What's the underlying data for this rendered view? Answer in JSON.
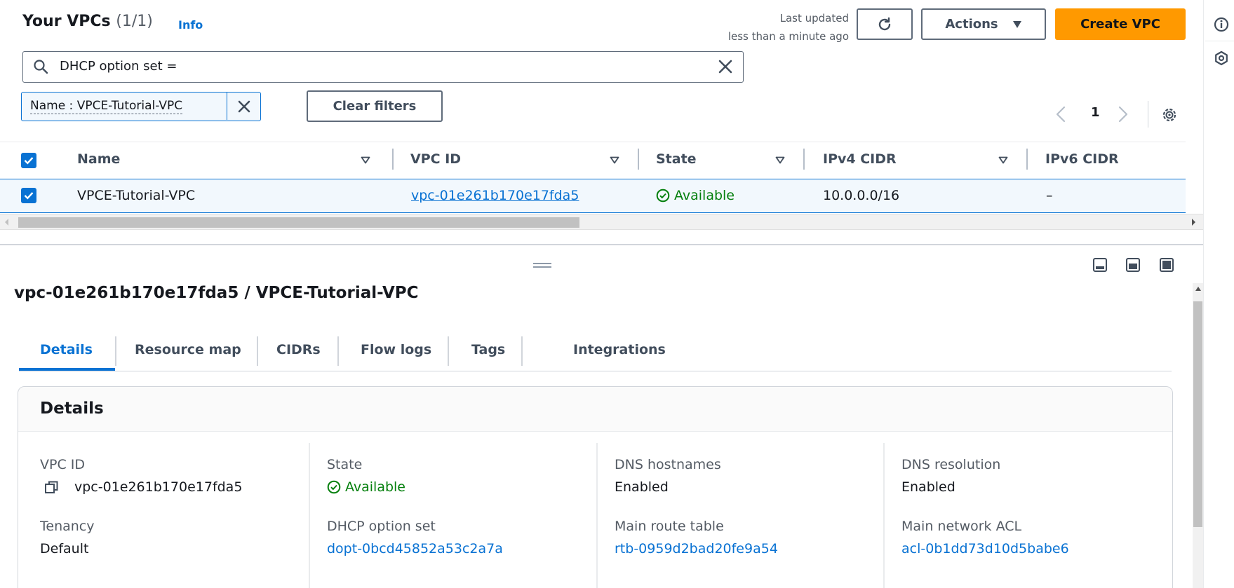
{
  "header": {
    "title": "Your VPCs",
    "count": "(1/1)",
    "info": "Info",
    "last_updated_line1": "Last updated",
    "last_updated_line2": "less than a minute ago",
    "actions_label": "Actions",
    "create_label": "Create VPC"
  },
  "search": {
    "value": "DHCP option set ="
  },
  "filters": {
    "token_label": "Name : VPCE-Tutorial-VPC",
    "clear_label": "Clear filters"
  },
  "pagination": {
    "page": "1"
  },
  "table": {
    "columns": [
      "Name",
      "VPC ID",
      "State",
      "IPv4 CIDR",
      "IPv6 CIDR"
    ],
    "rows": [
      {
        "name": "VPCE-Tutorial-VPC",
        "vpc_id": "vpc-01e261b170e17fda5",
        "state": "Available",
        "ipv4_cidr": "10.0.0.0/16",
        "ipv6_cidr": "–"
      }
    ]
  },
  "panel": {
    "title": "vpc-01e261b170e17fda5 / VPCE-Tutorial-VPC",
    "tabs": [
      "Details",
      "Resource map",
      "CIDRs",
      "Flow logs",
      "Tags",
      "Integrations"
    ],
    "details_title": "Details",
    "fields": {
      "vpc_id_label": "VPC ID",
      "vpc_id_value": "vpc-01e261b170e17fda5",
      "state_label": "State",
      "state_value": "Available",
      "dns_hostnames_label": "DNS hostnames",
      "dns_hostnames_value": "Enabled",
      "dns_resolution_label": "DNS resolution",
      "dns_resolution_value": "Enabled",
      "tenancy_label": "Tenancy",
      "tenancy_value": "Default",
      "dhcp_label": "DHCP option set",
      "dhcp_value": "dopt-0bcd45852a53c2a7a",
      "route_table_label": "Main route table",
      "route_table_value": "rtb-0959d2bad20fe9a54",
      "acl_label": "Main network ACL",
      "acl_value": "acl-0b1dd73d10d5babe6"
    }
  },
  "colors": {
    "accent": "#0972d3",
    "primary_button": "#ff9900",
    "success": "#037f0c"
  },
  "icons": [
    "search-icon",
    "close-icon",
    "refresh-icon",
    "caret-down-icon",
    "chevron-left-icon",
    "chevron-right-icon",
    "gear-icon",
    "sort-icon",
    "check-circle-icon",
    "copy-icon",
    "info-icon"
  ]
}
